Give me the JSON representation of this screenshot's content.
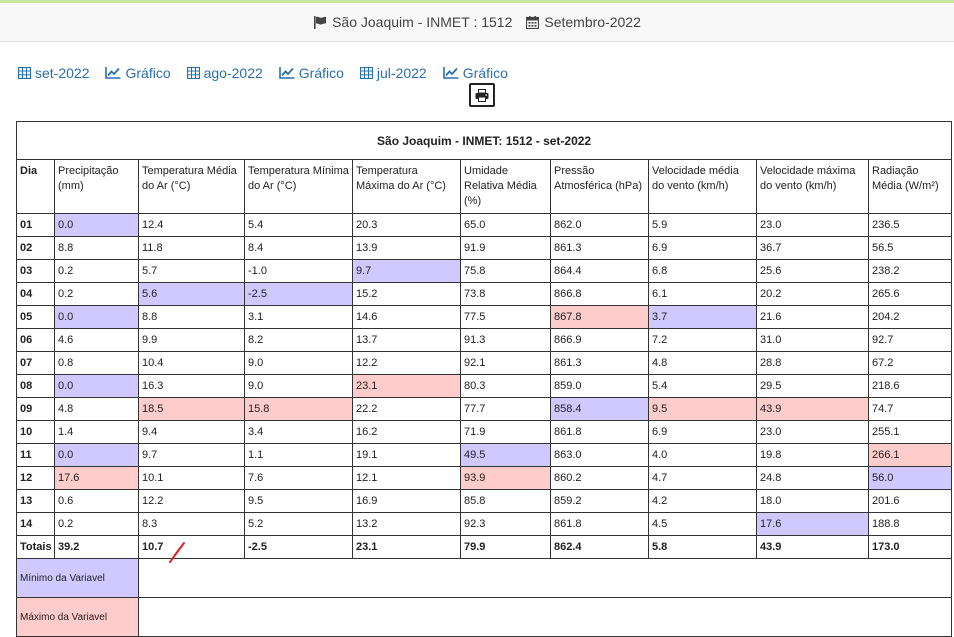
{
  "header": {
    "station": "São Joaquim - INMET : 1512",
    "period": "Setembro-2022"
  },
  "nav": [
    {
      "label": "set-2022",
      "icon": "table-icon"
    },
    {
      "label": "Gráfico",
      "icon": "line-chart-icon"
    },
    {
      "label": "ago-2022",
      "icon": "table-icon"
    },
    {
      "label": "Gráfico",
      "icon": "line-chart-icon"
    },
    {
      "label": "jul-2022",
      "icon": "table-icon"
    },
    {
      "label": "Gráfico",
      "icon": "line-chart-icon"
    }
  ],
  "colors": {
    "min": "#d0c9ff",
    "max": "#ffcccc",
    "link": "#2a6fb0"
  },
  "table": {
    "caption": "São Joaquim - INMET: 1512 - set-2022",
    "columns": [
      "Dia",
      "Precipitação (mm)",
      "Temperatura Média do Ar (°C)",
      "Temperatura Mínima do Ar (°C)",
      "Temperatura Máxima do Ar (°C)",
      "Umidade Relativa Média (%)",
      "Pressão Atmosférica (hPa)",
      "Velocidade média do vento (km/h)",
      "Velocidade máxima do vento (km/h)",
      "Radiação Média (W/m²)"
    ],
    "rows": [
      {
        "cells": [
          "01",
          "0.0",
          "12.4",
          "5.4",
          "20.3",
          "65.0",
          "862.0",
          "5.9",
          "23.0",
          "236.5"
        ],
        "hl": [
          "",
          "min",
          "",
          "",
          "",
          "",
          "",
          "",
          "",
          ""
        ]
      },
      {
        "cells": [
          "02",
          "8.8",
          "11.8",
          "8.4",
          "13.9",
          "91.9",
          "861.3",
          "6.9",
          "36.7",
          "56.5"
        ],
        "hl": [
          "",
          "",
          "",
          "",
          "",
          "",
          "",
          "",
          "",
          ""
        ]
      },
      {
        "cells": [
          "03",
          "0.2",
          "5.7",
          "-1.0",
          "9.7",
          "75.8",
          "864.4",
          "6.8",
          "25.6",
          "238.2"
        ],
        "hl": [
          "",
          "",
          "",
          "",
          "min",
          "",
          "",
          "",
          "",
          ""
        ]
      },
      {
        "cells": [
          "04",
          "0.2",
          "5.6",
          "-2.5",
          "15.2",
          "73.8",
          "866.8",
          "6.1",
          "20.2",
          "265.6"
        ],
        "hl": [
          "",
          "",
          "min",
          "min",
          "",
          "",
          "",
          "",
          "",
          ""
        ]
      },
      {
        "cells": [
          "05",
          "0.0",
          "8.8",
          "3.1",
          "14.6",
          "77.5",
          "867.8",
          "3.7",
          "21.6",
          "204.2"
        ],
        "hl": [
          "",
          "min",
          "",
          "",
          "",
          "",
          "max",
          "min",
          "",
          ""
        ]
      },
      {
        "cells": [
          "06",
          "4.6",
          "9.9",
          "8.2",
          "13.7",
          "91.3",
          "866.9",
          "7.2",
          "31.0",
          "92.7"
        ],
        "hl": [
          "",
          "",
          "",
          "",
          "",
          "",
          "",
          "",
          "",
          ""
        ]
      },
      {
        "cells": [
          "07",
          "0.8",
          "10.4",
          "9.0",
          "12.2",
          "92.1",
          "861.3",
          "4.8",
          "28.8",
          "67.2"
        ],
        "hl": [
          "",
          "",
          "",
          "",
          "",
          "",
          "",
          "",
          "",
          ""
        ]
      },
      {
        "cells": [
          "08",
          "0.0",
          "16.3",
          "9.0",
          "23.1",
          "80.3",
          "859.0",
          "5.4",
          "29.5",
          "218.6"
        ],
        "hl": [
          "",
          "min",
          "",
          "",
          "max",
          "",
          "",
          "",
          "",
          ""
        ]
      },
      {
        "cells": [
          "09",
          "4.8",
          "18.5",
          "15.8",
          "22.2",
          "77.7",
          "858.4",
          "9.5",
          "43.9",
          "74.7"
        ],
        "hl": [
          "",
          "",
          "max",
          "max",
          "",
          "",
          "min",
          "max",
          "max",
          ""
        ]
      },
      {
        "cells": [
          "10",
          "1.4",
          "9.4",
          "3.4",
          "16.2",
          "71.9",
          "861.8",
          "6.9",
          "23.0",
          "255.1"
        ],
        "hl": [
          "",
          "",
          "",
          "",
          "",
          "",
          "",
          "",
          "",
          ""
        ]
      },
      {
        "cells": [
          "11",
          "0.0",
          "9.7",
          "1.1",
          "19.1",
          "49.5",
          "863.0",
          "4.0",
          "19.8",
          "266.1"
        ],
        "hl": [
          "",
          "min",
          "",
          "",
          "",
          "min",
          "",
          "",
          "",
          "max"
        ]
      },
      {
        "cells": [
          "12",
          "17.6",
          "10.1",
          "7.6",
          "12.1",
          "93.9",
          "860.2",
          "4.7",
          "24.8",
          "56.0"
        ],
        "hl": [
          "",
          "max",
          "",
          "",
          "",
          "max",
          "",
          "",
          "",
          "min"
        ]
      },
      {
        "cells": [
          "13",
          "0.6",
          "12.2",
          "9.5",
          "16.9",
          "85.8",
          "859.2",
          "4.2",
          "18.0",
          "201.6"
        ],
        "hl": [
          "",
          "",
          "",
          "",
          "",
          "",
          "",
          "",
          "",
          ""
        ]
      },
      {
        "cells": [
          "14",
          "0.2",
          "8.3",
          "5.2",
          "13.2",
          "92.3",
          "861.8",
          "4.5",
          "17.6",
          "188.8"
        ],
        "hl": [
          "",
          "",
          "",
          "",
          "",
          "",
          "",
          "",
          "min",
          ""
        ]
      }
    ],
    "totals": [
      "Totais",
      "39.2",
      "10.7",
      "-2.5",
      "23.1",
      "79.9",
      "862.4",
      "5.8",
      "43.9",
      "173.0"
    ],
    "legend": {
      "min_label": "Mínimo da Variavel",
      "max_label": "Máximo da Variavel"
    }
  }
}
